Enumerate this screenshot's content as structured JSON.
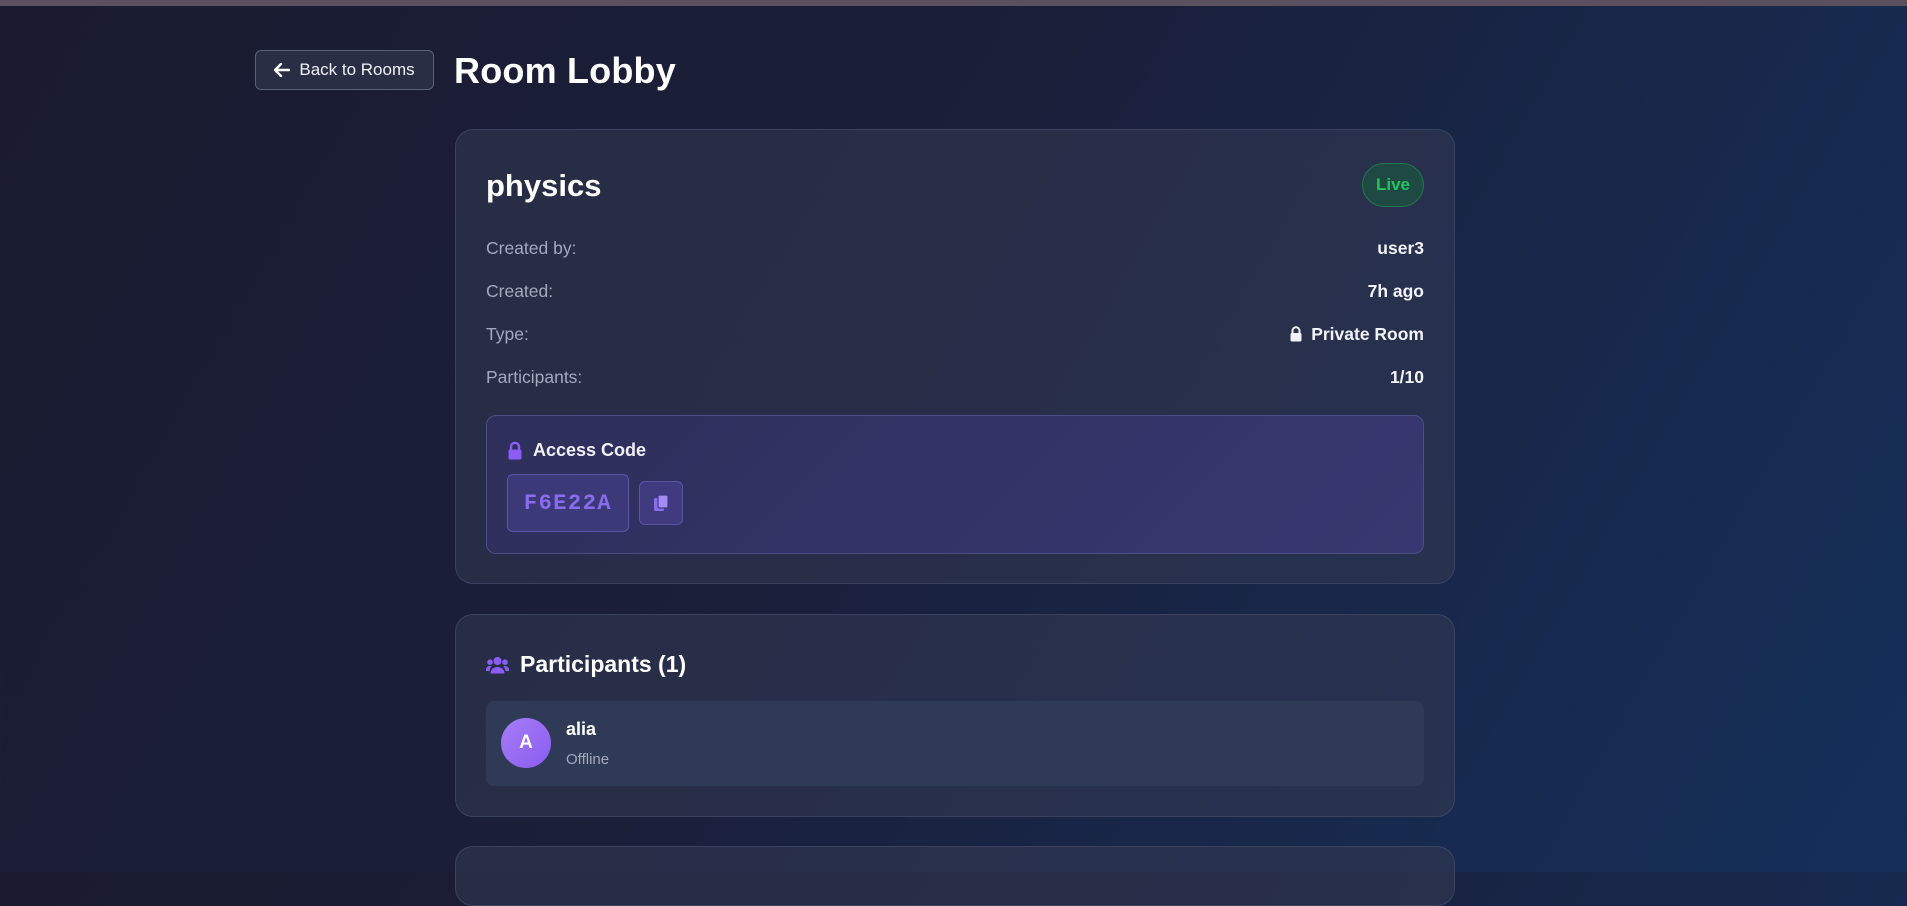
{
  "header": {
    "back_label": "Back to Rooms",
    "title": "Room Lobby"
  },
  "room": {
    "name": "physics",
    "status_badge": "Live",
    "details": [
      {
        "label": "Created by:",
        "value": "user3"
      },
      {
        "label": "Created:",
        "value": "7h ago"
      },
      {
        "label": "Type:",
        "value": "Private Room",
        "icon": "lock-icon"
      },
      {
        "label": "Participants:",
        "value": "1/10"
      }
    ],
    "access": {
      "title": "Access Code",
      "code": "F6E22A"
    }
  },
  "participants": {
    "title": "Participants (1)",
    "items": [
      {
        "initial": "A",
        "name": "alia",
        "status": "Offline"
      }
    ]
  },
  "colors": {
    "accent_purple": "#8b5cf6",
    "live_green": "#22c55e",
    "background_dark": "#1a1b30",
    "background_blue": "#14305a"
  }
}
